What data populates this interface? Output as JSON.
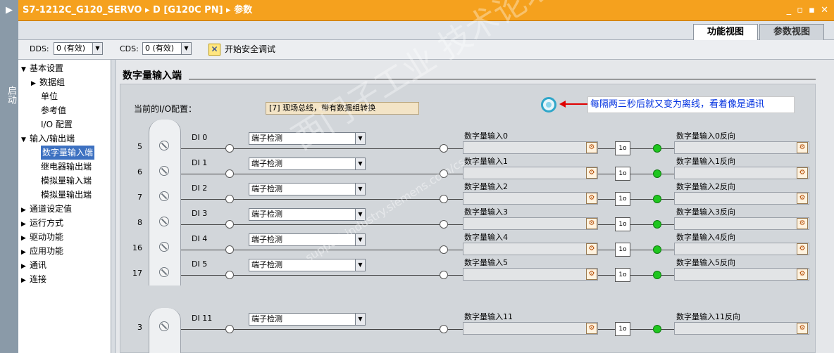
{
  "titlebar": {
    "breadcrumb": "S7-1212C_G120_SERVO  ▸  D [G120C PN]  ▸  参数",
    "controls": "_ ▫ ▪ ✕"
  },
  "left_strip": {
    "label": "启动"
  },
  "tabs": [
    {
      "label": "功能视图",
      "active": true
    },
    {
      "label": "参数视图",
      "active": false
    }
  ],
  "toolbar": {
    "dds_label": "DDS:",
    "dds_value": "0 (有效)",
    "cds_label": "CDS:",
    "cds_value": "0 (有效)",
    "safety_label": "开始安全调试"
  },
  "nav": [
    {
      "label": "基本设置",
      "level": 0,
      "expander": "▼"
    },
    {
      "label": "数据组",
      "level": 1,
      "expander": "▶"
    },
    {
      "label": "单位",
      "level": 2,
      "expander": ""
    },
    {
      "label": "参考值",
      "level": 2,
      "expander": ""
    },
    {
      "label": "I/O 配置",
      "level": 2,
      "expander": ""
    },
    {
      "label": "输入/输出端",
      "level": 0,
      "expander": "▼"
    },
    {
      "label": "数字量输入端",
      "level": 2,
      "expander": "",
      "selected": true
    },
    {
      "label": "继电器输出端",
      "level": 2,
      "expander": ""
    },
    {
      "label": "模拟量输入端",
      "level": 2,
      "expander": ""
    },
    {
      "label": "模拟量输出端",
      "level": 2,
      "expander": ""
    },
    {
      "label": "通道设定值",
      "level": 0,
      "expander": "▶"
    },
    {
      "label": "运行方式",
      "level": 0,
      "expander": "▶"
    },
    {
      "label": "驱动功能",
      "level": 0,
      "expander": "▶"
    },
    {
      "label": "应用功能",
      "level": 0,
      "expander": "▶"
    },
    {
      "label": "通讯",
      "level": 0,
      "expander": "▶"
    },
    {
      "label": "连接",
      "level": 0,
      "expander": "▶"
    }
  ],
  "main": {
    "title": "数字量输入端",
    "io_config_label": "当前的I/O配置：",
    "io_config_value": "[7] 现场总线，带有数据组转换",
    "annotation": "每隔两三秒后就又变为离线，看着像是通讯",
    "inputs": [
      {
        "pin": "5",
        "name": "DI 0",
        "mode": "端子检测",
        "signal": "数字量输入0",
        "inverted": "数字量输入0反向"
      },
      {
        "pin": "6",
        "name": "DI 1",
        "mode": "端子检测",
        "signal": "数字量输入1",
        "inverted": "数字量输入1反向"
      },
      {
        "pin": "7",
        "name": "DI 2",
        "mode": "端子检测",
        "signal": "数字量输入2",
        "inverted": "数字量输入2反向"
      },
      {
        "pin": "8",
        "name": "DI 3",
        "mode": "端子检测",
        "signal": "数字量输入3",
        "inverted": "数字量输入3反向"
      },
      {
        "pin": "16",
        "name": "DI 4",
        "mode": "端子检测",
        "signal": "数字量输入4",
        "inverted": "数字量输入4反向"
      },
      {
        "pin": "17",
        "name": "DI 5",
        "mode": "端子检测",
        "signal": "数字量输入5",
        "inverted": "数字量输入5反向"
      },
      {
        "pin": "3",
        "name": "DI 11",
        "mode": "端子检测",
        "signal": "数字量输入11",
        "inverted": "数字量输入11反向"
      }
    ],
    "watermark": "西门子工业  技术论坛",
    "watermark_url": "support.industry.siemens.com/cs",
    "inverter_symbol": "1",
    "status_led_color": "#1fc61f",
    "accent_color": "#f5a11e",
    "selection_color": "#3d71c1"
  }
}
